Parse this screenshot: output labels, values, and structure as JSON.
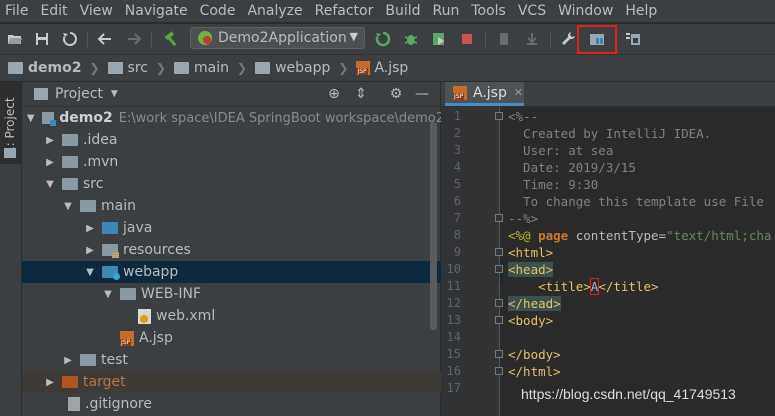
{
  "menu": [
    "File",
    "Edit",
    "View",
    "Navigate",
    "Code",
    "Analyze",
    "Refactor",
    "Build",
    "Run",
    "Tools",
    "VCS",
    "Window",
    "Help"
  ],
  "toolbar": {
    "run_config": "Demo2Application"
  },
  "breadcrumb": [
    "demo2",
    "src",
    "main",
    "webapp",
    "A.jsp"
  ],
  "left_strip": {
    "project_tab": "1: Project"
  },
  "project_panel": {
    "title": "Project",
    "tree": [
      {
        "label": "demo2",
        "path": "E:\\work space\\IDEA SpringBoot workspace\\demo2"
      },
      {
        "label": ".idea"
      },
      {
        "label": ".mvn"
      },
      {
        "label": "src"
      },
      {
        "label": "main"
      },
      {
        "label": "java"
      },
      {
        "label": "resources"
      },
      {
        "label": "webapp"
      },
      {
        "label": "WEB-INF"
      },
      {
        "label": "web.xml"
      },
      {
        "label": "A.jsp"
      },
      {
        "label": "test"
      },
      {
        "label": "target"
      },
      {
        "label": ".gitignore"
      }
    ]
  },
  "editor": {
    "tab": "A.jsp",
    "line_numbers": [
      "1",
      "2",
      "3",
      "4",
      "5",
      "6",
      "7",
      "8",
      "9",
      "10",
      "11",
      "12",
      "13",
      "14",
      "15",
      "16",
      "17"
    ],
    "lines": {
      "l1": "<%--",
      "l2": "  Created by IntelliJ IDEA.",
      "l3": "  User: at sea",
      "l4": "  Date: 2019/3/15",
      "l5": "  Time: 9:30",
      "l6": "  To change this template use File",
      "l7": "--%>",
      "l8_open": "<%@ ",
      "l8_kw": "page",
      "l8_attr": " contentType=",
      "l8_str": "\"text/html;cha",
      "l9": "<html>",
      "l10": "<head>",
      "l11_open": "    <title>",
      "l11_text": "A",
      "l11_close": "</title>",
      "l12": "</head>",
      "l13": "<body>",
      "l15": "</body>",
      "l16": "</html>"
    }
  },
  "watermark": "https://blog.csdn.net/qq_41749513",
  "colors": {
    "background": "#2b2b2b",
    "panel": "#3c3f41",
    "selection": "#0d293e",
    "highlight_box": "#e0201e"
  }
}
